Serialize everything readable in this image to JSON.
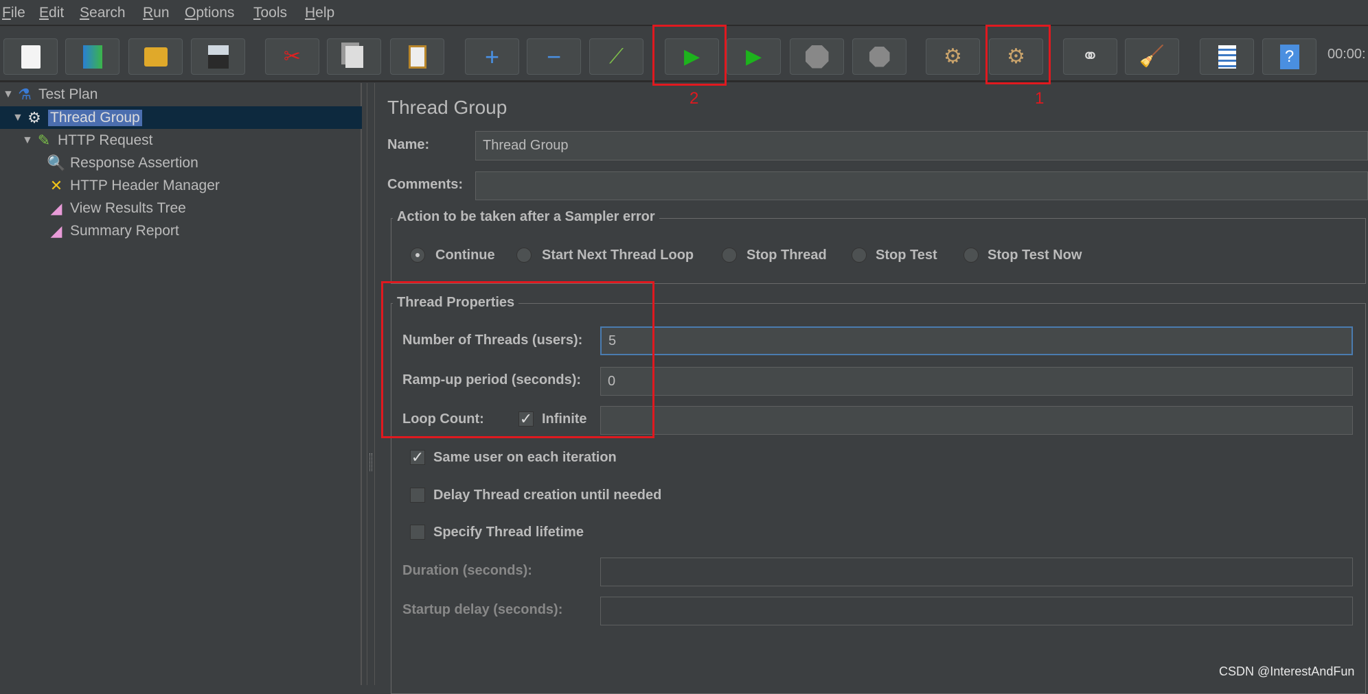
{
  "menu": [
    {
      "label": "File",
      "mn": "F",
      "rest": "ile"
    },
    {
      "label": "Edit",
      "mn": "E",
      "rest": "dit"
    },
    {
      "label": "Search",
      "mn": "S",
      "rest": "earch"
    },
    {
      "label": "Run",
      "mn": "R",
      "rest": "un"
    },
    {
      "label": "Options",
      "mn": "O",
      "rest": "ptions"
    },
    {
      "label": "Tools",
      "mn": "T",
      "rest": "ools"
    },
    {
      "label": "Help",
      "mn": "H",
      "rest": "elp"
    }
  ],
  "toolbar": {
    "buttons": [
      "new",
      "templates",
      "open",
      "save",
      "cut",
      "copy",
      "paste",
      "expand",
      "collapse",
      "toggle",
      "start",
      "start-no-pauses",
      "stop",
      "shutdown",
      "clear",
      "clear-all",
      "search",
      "reset-search",
      "function-helper",
      "help"
    ],
    "timer": "00:00:",
    "annotations": {
      "start_label": "2",
      "clear_all_label": "1"
    },
    "annotation_color": "#e0191f"
  },
  "tree": {
    "items": [
      {
        "label": "Test Plan",
        "icon": "flask-icon"
      },
      {
        "label": "Thread Group",
        "icon": "gear-icon",
        "selected": true
      },
      {
        "label": "HTTP Request",
        "icon": "pipette-icon"
      },
      {
        "label": "Response Assertion",
        "icon": "magnifier-icon"
      },
      {
        "label": "HTTP Header Manager",
        "icon": "tools-icon"
      },
      {
        "label": "View Results Tree",
        "icon": "graph-icon"
      },
      {
        "label": "Summary Report",
        "icon": "graph-icon"
      }
    ]
  },
  "panel": {
    "title": "Thread Group",
    "name_label": "Name:",
    "name_value": "Thread Group",
    "comments_label": "Comments:",
    "comments_value": "",
    "error_action": {
      "legend": "Action to be taken after a Sampler error",
      "options": [
        "Continue",
        "Start Next Thread Loop",
        "Stop Thread",
        "Stop Test",
        "Stop Test Now"
      ],
      "selected": "Continue"
    },
    "thread_properties": {
      "legend": "Thread Properties",
      "threads_label": "Number of Threads (users):",
      "threads_value": "5",
      "rampup_label": "Ramp-up period (seconds):",
      "rampup_value": "0",
      "loop_label": "Loop Count:",
      "infinite_label": "Infinite",
      "infinite_checked": true,
      "loop_value": "",
      "same_user_label": "Same user on each iteration",
      "same_user_checked": true,
      "delay_label": "Delay Thread creation until needed",
      "delay_checked": false,
      "lifetime_label": "Specify Thread lifetime",
      "lifetime_checked": false,
      "duration_label": "Duration (seconds):",
      "duration_value": "",
      "startup_label": "Startup delay (seconds):",
      "startup_value": ""
    }
  },
  "watermark": "CSDN @InterestAndFun"
}
